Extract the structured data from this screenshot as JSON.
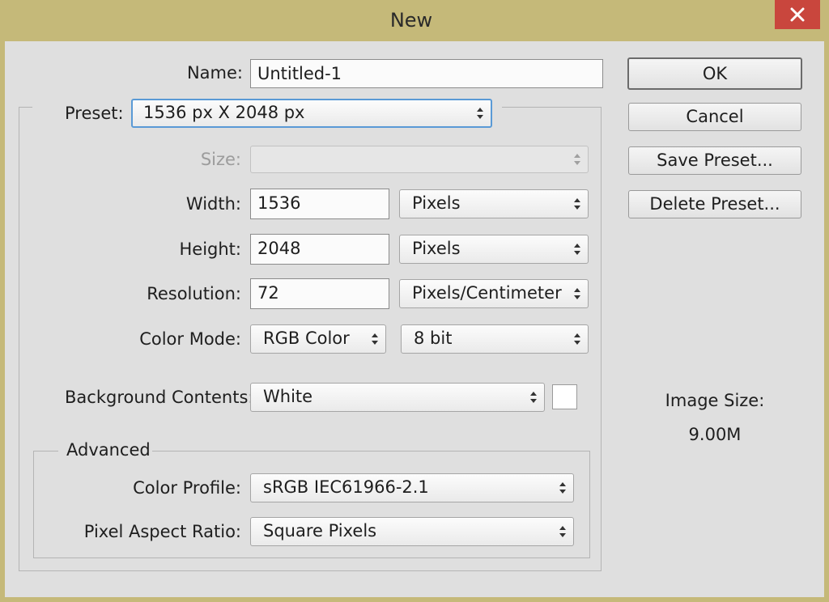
{
  "window": {
    "title": "New"
  },
  "form": {
    "name_label": "Name:",
    "name_value": "Untitled-1",
    "preset_label": "Preset:",
    "preset_value": "1536 px X 2048 px",
    "size_label": "Size:",
    "size_value": "",
    "width_label": "Width:",
    "width_value": "1536",
    "width_unit": "Pixels",
    "height_label": "Height:",
    "height_value": "2048",
    "height_unit": "Pixels",
    "resolution_label": "Resolution:",
    "resolution_value": "72",
    "resolution_unit": "Pixels/Centimeter",
    "color_mode_label": "Color Mode:",
    "color_mode_value": "RGB Color",
    "bit_depth_value": "8 bit",
    "background_label": "Background Contents:",
    "background_value": "White",
    "background_swatch_color": "#ffffff"
  },
  "advanced": {
    "legend": "Advanced",
    "color_profile_label": "Color Profile:",
    "color_profile_value": "sRGB IEC61966-2.1",
    "pixel_aspect_label": "Pixel Aspect Ratio:",
    "pixel_aspect_value": "Square Pixels"
  },
  "buttons": {
    "ok": "OK",
    "cancel": "Cancel",
    "save_preset": "Save Preset...",
    "delete_preset": "Delete Preset..."
  },
  "image_size": {
    "label": "Image Size:",
    "value": "9.00M"
  },
  "colors": {
    "title_bar": "#c5b979",
    "close_button": "#c9463d",
    "dialog_background": "#dfdfdf",
    "focus_ring": "#5a9ad6"
  },
  "icons": {
    "close": "close-icon",
    "dropdown": "updown-arrows-icon"
  }
}
